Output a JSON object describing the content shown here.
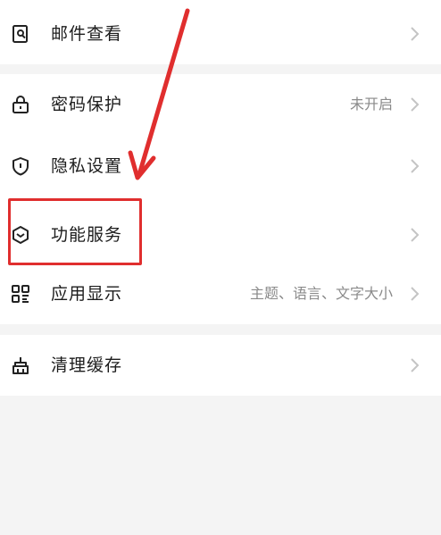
{
  "settings": {
    "mail_view": {
      "label": "邮件查看"
    },
    "password_protect": {
      "label": "密码保护",
      "value": "未开启"
    },
    "privacy": {
      "label": "隐私设置"
    },
    "features": {
      "label": "功能服务"
    },
    "display": {
      "label": "应用显示",
      "value": "主题、语言、文字大小"
    },
    "cache": {
      "label": "清理缓存"
    }
  },
  "icons": {
    "mail_view": "mail-search-icon",
    "password_protect": "lock-icon",
    "privacy": "shield-icon",
    "features": "hexagon-check-icon",
    "display": "grid-icon",
    "cache": "broom-icon",
    "chevron": "chevron-right-icon"
  },
  "colors": {
    "annotation_red": "#e02e2e",
    "background": "#f4f4f4",
    "card": "#ffffff",
    "text_primary": "#1c1c1c",
    "text_secondary": "#8a8a8a"
  }
}
